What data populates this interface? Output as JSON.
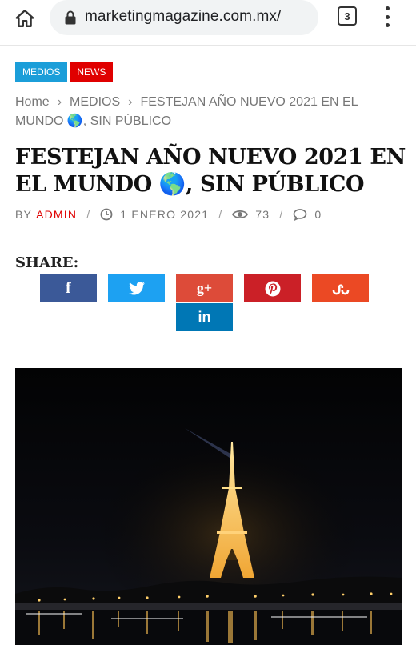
{
  "browser": {
    "url": "marketingmagazine.com.mx/",
    "tab_count": "3",
    "icons": [
      "home-icon",
      "lock-icon",
      "tab-switcher-icon",
      "more-vert-icon"
    ]
  },
  "article": {
    "badges": [
      "MEDIOS",
      "NEWS"
    ],
    "breadcrumb": {
      "home": "Home",
      "category": "MEDIOS",
      "current": "FESTEJAN AÑO NUEVO 2021 EN EL MUNDO 🌎, SIN PÚBLICO"
    },
    "title": "FESTEJAN AÑO NUEVO 2021 EN EL MUNDO 🌎, SIN PÚBLICO",
    "meta": {
      "by_label": "BY",
      "author": "ADMIN",
      "date": "1 ENERO 2021",
      "views": "73",
      "comments": "0"
    },
    "share": {
      "label": "SHARE:",
      "facebook": "f",
      "googleplus": "g+",
      "linkedin": "in"
    },
    "colors": {
      "medios": "#1b9ed9",
      "news": "#e00000",
      "facebook": "#3b5998",
      "twitter": "#1da1f2",
      "googleplus": "#dd4b39",
      "pinterest": "#cb2027",
      "stumbleupon": "#eb4924",
      "linkedin": "#0077b5"
    }
  }
}
